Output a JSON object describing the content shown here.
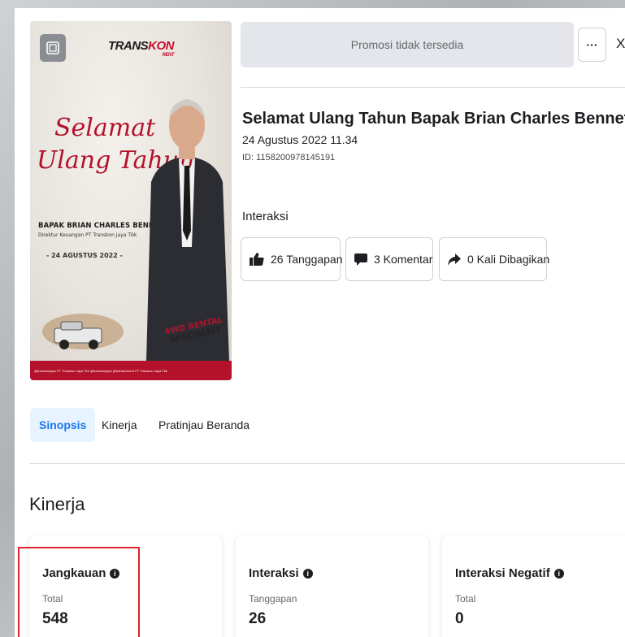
{
  "poster": {
    "logo_main": "TRANS",
    "logo_accent": "KON",
    "logo_sub": "RENT",
    "script_line1": "Selamat",
    "script_line2": "Ulang Tahun",
    "name": "BAPAK BRIAN CHARLES BENNETT",
    "role": "Direktur Keuangan PT Transkon Jaya Tbk",
    "date": "- 24 AGUSTUS 2022 -",
    "badge_line1": "4WD RENTAL",
    "badge_line2": "SPECIALIST",
    "footer": "@transkonjaya  PT Transkon Jaya Tbk  @transkonjaya  @transkonrent  PT Transkon Jaya Tbk"
  },
  "header": {
    "promo_text": "Promosi tidak tersedia",
    "more_label": "···",
    "close_label": "X"
  },
  "post": {
    "title": "Selamat Ulang Tahun Bapak Brian Charles Bennett selaku Dire...",
    "date": "24 Agustus 2022 11.34",
    "id": "ID: 1158200978145191",
    "interaction_label": "Interaksi",
    "reactions": "26 Tanggapan",
    "comments": "3 Komentar",
    "shares": "0 Kali Dibagikan"
  },
  "tabs": [
    {
      "label": "Sinopsis",
      "active": true
    },
    {
      "label": "Kinerja",
      "active": false
    },
    {
      "label": "Pratinjau Beranda",
      "active": false
    }
  ],
  "performance": {
    "heading": "Kinerja",
    "cards": [
      {
        "title": "Jangkauan",
        "sub": "Total",
        "value": "548"
      },
      {
        "title": "Interaksi",
        "sub": "Tanggapan",
        "value": "26"
      },
      {
        "title": "Interaksi Negatif",
        "sub": "Total",
        "value": "0"
      }
    ]
  },
  "colors": {
    "accent_blue": "#1877f2",
    "tab_active_bg": "#e7f3ff",
    "highlight_red": "#e0232d",
    "brand_red": "#b3122a"
  }
}
